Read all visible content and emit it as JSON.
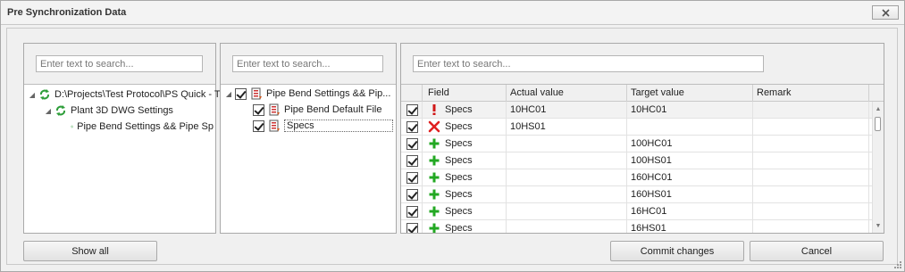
{
  "window": {
    "title": "Pre Synchronization Data"
  },
  "left_panel": {
    "search_placeholder": "Enter text to search...",
    "tree": [
      {
        "label": "D:\\Projects\\Test Protocol\\PS Quick - T"
      },
      {
        "label": "Plant 3D DWG Settings"
      },
      {
        "label": "Pipe Bend Settings && Pipe Sp"
      }
    ]
  },
  "middle_panel": {
    "search_placeholder": "Enter text to search...",
    "tree": [
      {
        "label": "Pipe Bend Settings && Pip..."
      },
      {
        "label": "Pipe Bend Default File"
      },
      {
        "label": "Specs"
      }
    ]
  },
  "right_panel": {
    "search_placeholder": "Enter text to search...",
    "columns": [
      "Field",
      "Actual value",
      "Target value",
      "Remark"
    ],
    "rows": [
      {
        "status": "warning",
        "field": "Specs",
        "actual": "10HC01",
        "target": "10HC01",
        "remark": ""
      },
      {
        "status": "delete",
        "field": "Specs",
        "actual": "10HS01",
        "target": "",
        "remark": ""
      },
      {
        "status": "add",
        "field": "Specs",
        "actual": "",
        "target": "100HC01",
        "remark": ""
      },
      {
        "status": "add",
        "field": "Specs",
        "actual": "",
        "target": "100HS01",
        "remark": ""
      },
      {
        "status": "add",
        "field": "Specs",
        "actual": "",
        "target": "160HC01",
        "remark": ""
      },
      {
        "status": "add",
        "field": "Specs",
        "actual": "",
        "target": "160HS01",
        "remark": ""
      },
      {
        "status": "add",
        "field": "Specs",
        "actual": "",
        "target": "16HC01",
        "remark": ""
      },
      {
        "status": "add",
        "field": "Specs",
        "actual": "",
        "target": "16HS01",
        "remark": ""
      }
    ]
  },
  "buttons": {
    "show_all": "Show all",
    "commit": "Commit changes",
    "cancel": "Cancel"
  },
  "icons": {
    "close": "close-icon",
    "sync": "sync-icon",
    "list": "settings-list-icon",
    "warning": "exclamation-icon",
    "delete": "red-x-icon",
    "add": "green-plus-icon"
  },
  "colors": {
    "sync_green": "#2e9e3a",
    "warning_red": "#d01818",
    "delete_red": "#e02020",
    "add_green": "#23a823"
  }
}
